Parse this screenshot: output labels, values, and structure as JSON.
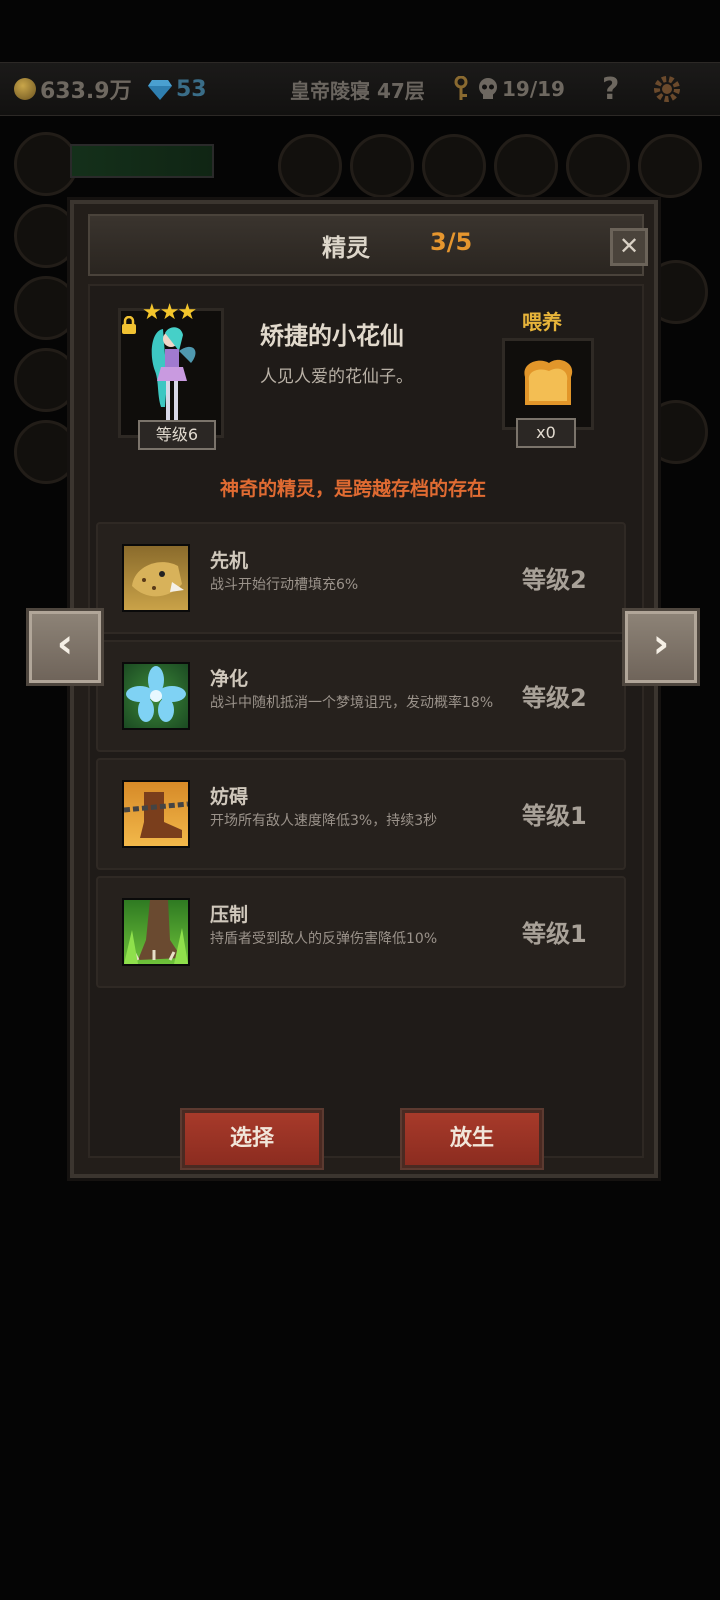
{
  "hud": {
    "gold": "633.9万",
    "gems": "53",
    "floor": "皇帝陵寝 47层",
    "skulls": "19/19",
    "help": "?"
  },
  "dialog": {
    "title": "精灵",
    "count": "3/5",
    "close": "✕"
  },
  "spirit": {
    "stars": "★★★",
    "level": "等级6",
    "name": "矫捷的小花仙",
    "description": "人见人爱的花仙子。",
    "feed_label": "喂养",
    "feed_count": "x0",
    "tagline": "神奇的精灵，是跨越存档的存在"
  },
  "skills": [
    {
      "name": "先机",
      "desc": "战斗开始行动槽填充6%",
      "level": "等级2",
      "icon": "leopard-icon"
    },
    {
      "name": "净化",
      "desc": "战斗中随机抵消一个梦境诅咒，发动概率18%",
      "level": "等级2",
      "icon": "blue-flower-icon"
    },
    {
      "name": "妨碍",
      "desc": "开场所有敌人速度降低3%，持续3秒",
      "level": "等级1",
      "icon": "chained-boot-icon"
    },
    {
      "name": "压制",
      "desc": "持盾者受到敌人的反弹伤害降低10%",
      "level": "等级1",
      "icon": "claw-grass-icon"
    }
  ],
  "buttons": {
    "select": "选择",
    "release": "放生",
    "prev": "‹",
    "next": "›"
  }
}
